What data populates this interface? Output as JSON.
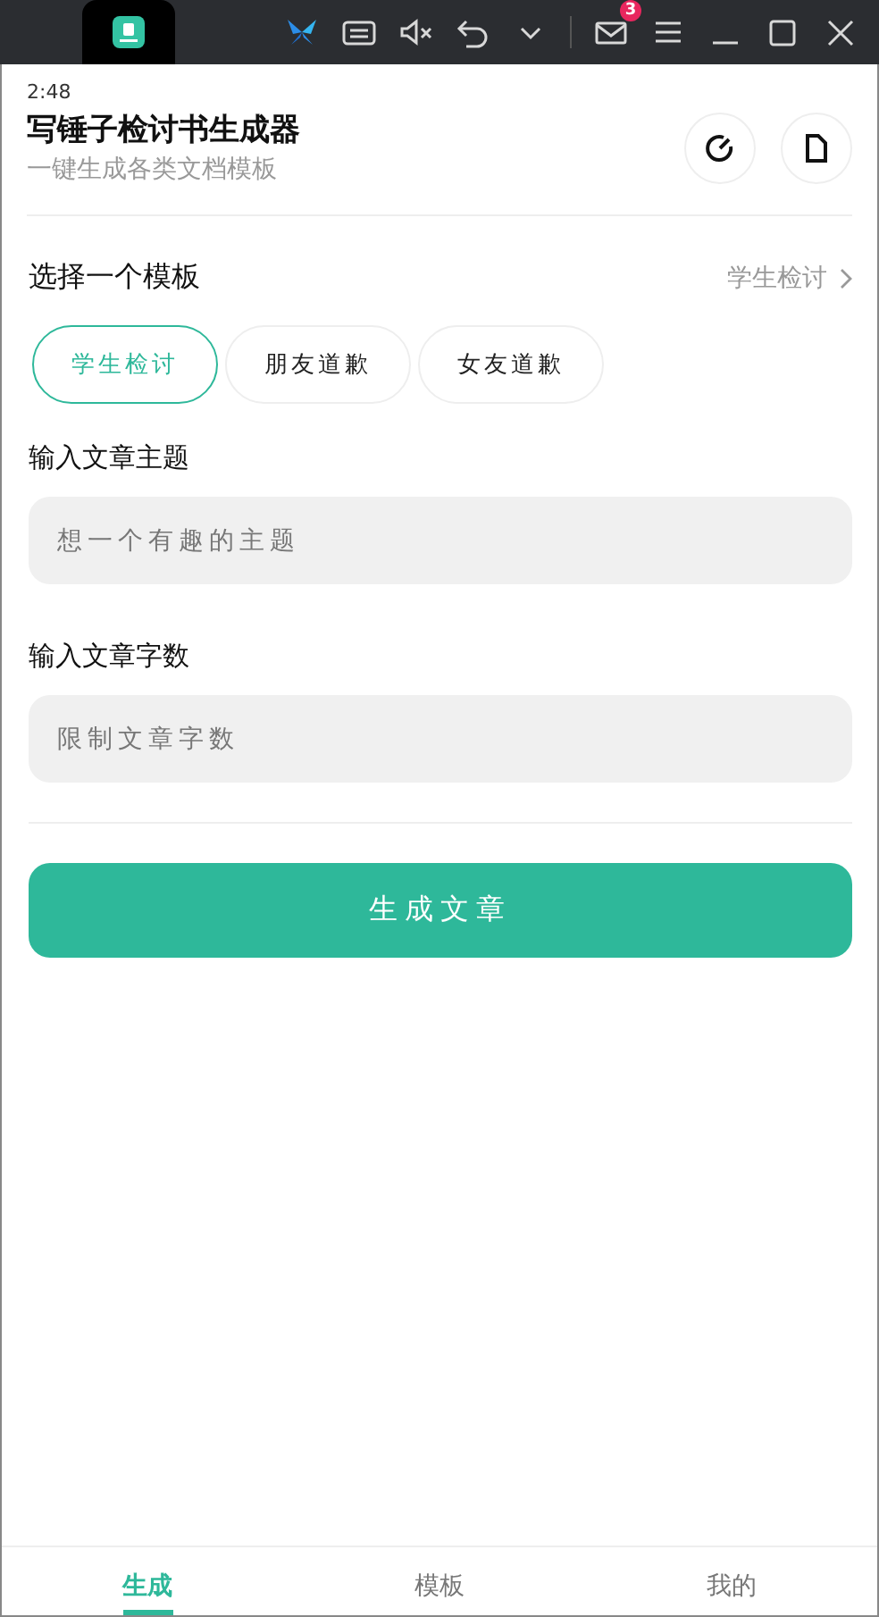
{
  "emulator_bar": {
    "mail_badge": "3"
  },
  "status_bar": {
    "time": "2:48"
  },
  "header": {
    "title": "写锤子检讨书生成器",
    "subtitle": "一键生成各类文档模板"
  },
  "template_section": {
    "label": "选择一个模板",
    "current": "学生检讨",
    "chips": [
      {
        "label": "学生检讨",
        "selected": true
      },
      {
        "label": "朋友道歉",
        "selected": false
      },
      {
        "label": "女友道歉",
        "selected": false
      }
    ]
  },
  "fields": [
    {
      "label": "输入文章主题",
      "placeholder": "想一个有趣的主题"
    },
    {
      "label": "输入文章字数",
      "placeholder": "限制文章字数"
    }
  ],
  "generate_button": "生成文章",
  "bottom_nav": [
    {
      "label": "生成",
      "selected": true
    },
    {
      "label": "模板",
      "selected": false
    },
    {
      "label": "我的",
      "selected": false
    }
  ]
}
